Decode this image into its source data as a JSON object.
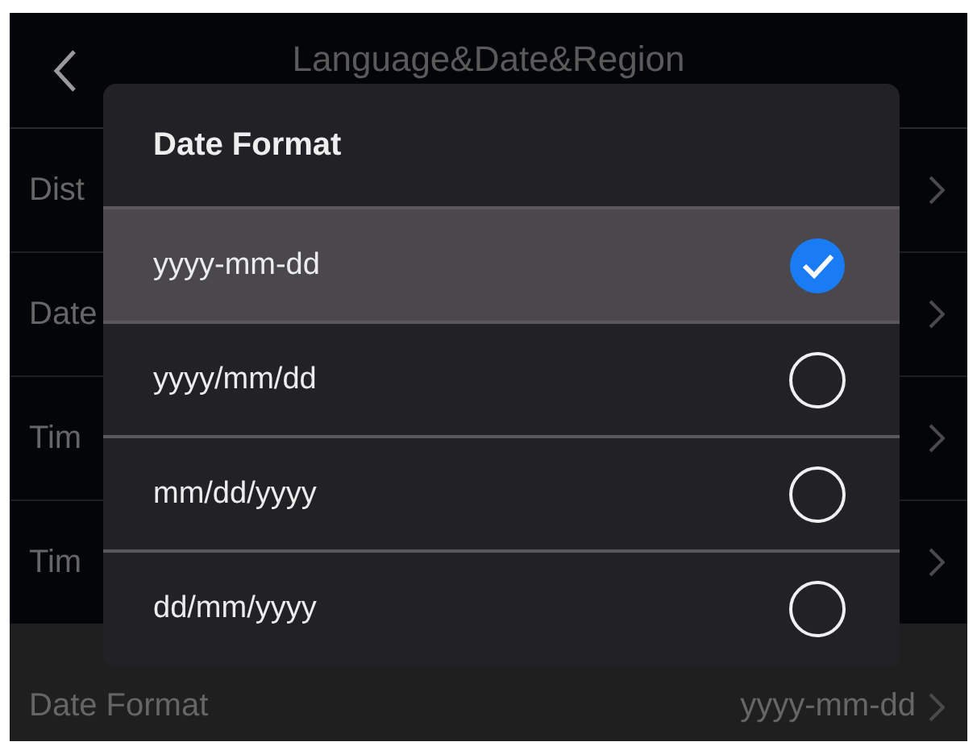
{
  "header": {
    "title": "Language&Date&Region"
  },
  "rows": [
    {
      "label": "Dist",
      "selected": false
    },
    {
      "label": "Date",
      "selected": false
    },
    {
      "label": "Tim",
      "selected": false
    },
    {
      "label": "Tim",
      "selected": false
    },
    {
      "label": "Date Format",
      "value": "yyyy-mm-dd",
      "selected": true
    }
  ],
  "dialog": {
    "title": "Date Format",
    "options": [
      {
        "label": "yyyy-mm-dd",
        "selected": true
      },
      {
        "label": "yyyy/mm/dd",
        "selected": false
      },
      {
        "label": "mm/dd/yyyy",
        "selected": false
      },
      {
        "label": "dd/mm/yyyy",
        "selected": false
      }
    ]
  }
}
